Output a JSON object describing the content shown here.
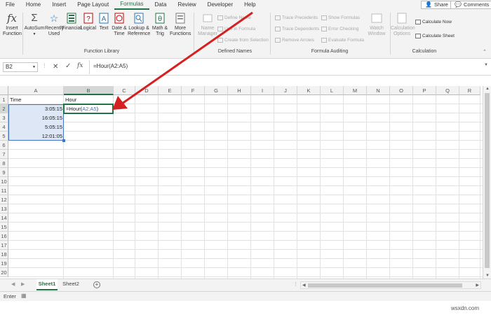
{
  "menu": {
    "tabs": [
      "File",
      "Home",
      "Insert",
      "Page Layout",
      "Formulas",
      "Data",
      "Review",
      "Developer",
      "Help"
    ],
    "active_tab": "Formulas",
    "share_label": "Share",
    "comments_label": "Comments"
  },
  "ribbon": {
    "insert_function": "Insert Function",
    "autosum": "AutoSum",
    "recently_used": "Recently Used",
    "financial": "Financial",
    "logical": "Logical",
    "text": "Text",
    "date_time": "Date & Time",
    "lookup_reference": "Lookup & Reference",
    "math_trig": "Math & Trig",
    "more_functions": "More Functions",
    "function_library_label": "Function Library",
    "name_manager": "Name Manager",
    "define_name": "Define Name",
    "use_in_formula": "Use in Formula",
    "create_from_selection": "Create from Selection",
    "defined_names_label": "Defined Names",
    "trace_precedents": "Trace Precedents",
    "trace_dependents": "Trace Dependents",
    "remove_arrows": "Remove Arrows",
    "show_formulas": "Show Formulas",
    "error_checking": "Error Checking",
    "evaluate_formula": "Evaluate Formula",
    "watch_window": "Watch Window",
    "formula_auditing_label": "Formula Auditing",
    "calculation_options": "Calculation Options",
    "calculate_now": "Calculate Now",
    "calculate_sheet": "Calculate Sheet",
    "calculation_label": "Calculation"
  },
  "formula_bar": {
    "name_box": "B2",
    "fx": "fx",
    "formula": "=Hour(A2:A5)"
  },
  "sheet": {
    "columns": [
      "A",
      "B",
      "C",
      "D",
      "E",
      "F",
      "G",
      "H",
      "I",
      "J",
      "K",
      "L",
      "M",
      "N",
      "O",
      "P",
      "Q",
      "R"
    ],
    "rows": [
      "1",
      "2",
      "3",
      "4",
      "5",
      "6",
      "7",
      "8",
      "9",
      "10",
      "11",
      "12",
      "13",
      "14",
      "15",
      "16",
      "17",
      "18",
      "19",
      "20"
    ],
    "a1": "Time",
    "b1": "Hour",
    "a2": "3:05:15",
    "a3": "16:05:15",
    "a4": "5:05:15",
    "a5": "12:01:05",
    "b2_prefix": "=Hour(",
    "b2_ref": "A2:A5",
    "b2_suffix": ")"
  },
  "tabs": {
    "sheet1": "Sheet1",
    "sheet2": "Sheet2"
  },
  "status": {
    "mode": "Enter"
  },
  "colors": {
    "accent": "#217346",
    "arrow": "#d42020",
    "ref_blue": "#4472c4",
    "selection_fill": "#dde7f5"
  },
  "watermark": "wsxdn.com"
}
